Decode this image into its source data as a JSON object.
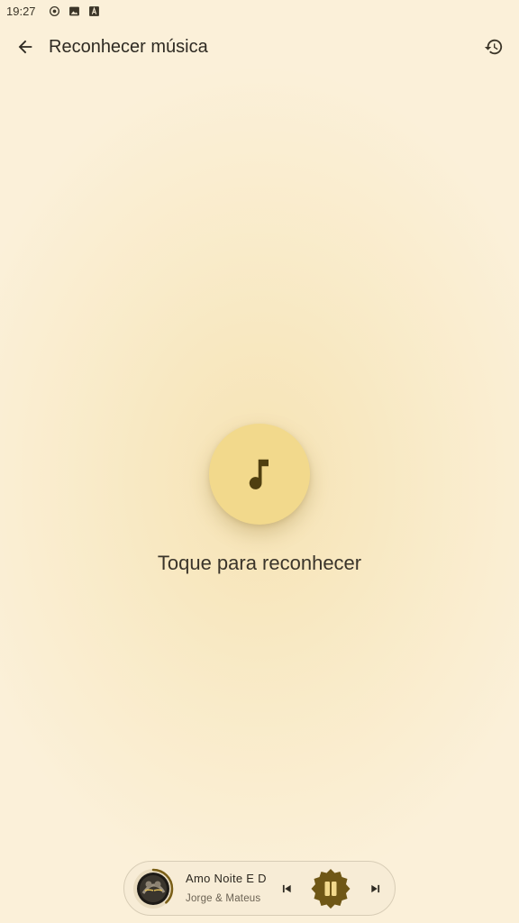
{
  "status_bar": {
    "time": "19:27",
    "icons": [
      "cast-icon",
      "image-icon",
      "font-icon"
    ]
  },
  "app_bar": {
    "title": "Reconhecer música",
    "back_icon": "arrow-back-icon",
    "history_icon": "history-icon"
  },
  "main": {
    "button_icon": "music-note-icon",
    "prompt": "Toque para reconhecer"
  },
  "mini_player": {
    "title": "Amo Noite E D",
    "artist": "Jorge & Mateus",
    "state": "playing",
    "progress": 0.38,
    "controls": [
      "skip-previous-icon",
      "pause-icon",
      "skip-next-icon"
    ]
  },
  "colors": {
    "background": "#fbf0d9",
    "accent": "#f2d98c",
    "icon_dark": "#4f3f10",
    "play_button": "#6f5716"
  }
}
